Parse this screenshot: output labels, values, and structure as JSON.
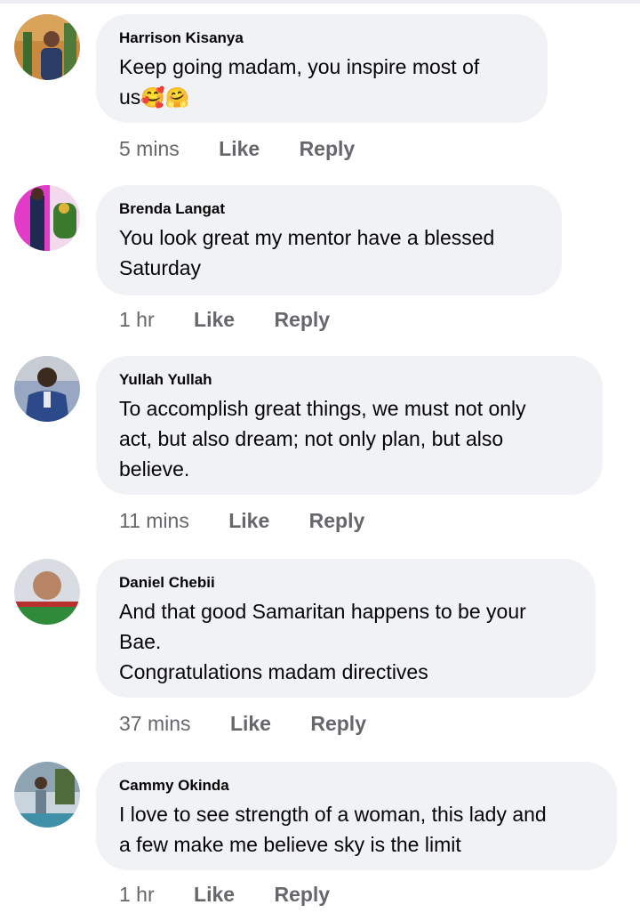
{
  "comments": [
    {
      "author": "Harrison Kisanya",
      "lines": [
        "Keep going madam, you inspire most of",
        "us"
      ],
      "emojis": [
        "🥰",
        "🤗"
      ],
      "time": "5 mins",
      "like_label": "Like",
      "reply_label": "Reply",
      "avatar_colors": [
        "#c98a3e",
        "#3d6b2e",
        "#2b3c66"
      ]
    },
    {
      "author": "Brenda Langat",
      "lines": [
        "You look great my mentor have a blessed",
        "Saturday"
      ],
      "time": "1 hr",
      "like_label": "Like",
      "reply_label": "Reply",
      "avatar_colors": [
        "#e23bc8",
        "#3a7a2d",
        "#f3d9ee"
      ]
    },
    {
      "author": "Yullah Yullah",
      "lines": [
        "To accomplish great things, we must not only",
        "act, but also dream; not only plan, but also",
        "believe."
      ],
      "time": "11 mins",
      "like_label": "Like",
      "reply_label": "Reply",
      "avatar_colors": [
        "#2c4a8a",
        "#3b2a1e",
        "#9aa7c2"
      ]
    },
    {
      "author": "Daniel Chebii",
      "lines": [
        "And that good Samaritan happens to be your",
        "Bae.",
        "Congratulations madam directives"
      ],
      "time": "37 mins",
      "like_label": "Like",
      "reply_label": "Reply",
      "avatar_colors": [
        "#d9dde3",
        "#b88466",
        "#2f8a3a"
      ]
    },
    {
      "author": "Cammy Okinda",
      "lines": [
        "I love to see strength of a woman, this lady and",
        "a few make me believe sky is the limit"
      ],
      "time": "1 hr",
      "like_label": "Like",
      "reply_label": "Reply",
      "avatar_colors": [
        "#6b7f8f",
        "#4f6b3c",
        "#c9d4dc"
      ]
    }
  ]
}
